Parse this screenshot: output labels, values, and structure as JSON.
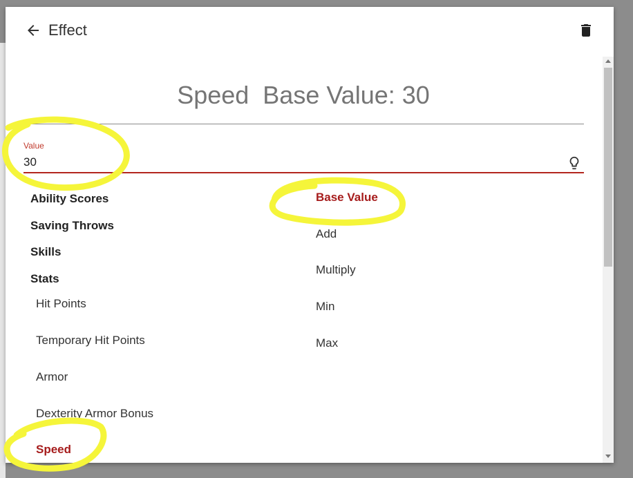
{
  "dialog": {
    "title": "Effect",
    "heading": "Speed  Base Value: 30"
  },
  "icons": {
    "back": "arrow-left-icon",
    "delete": "trash-icon",
    "hint": "lightbulb-icon"
  },
  "value_field": {
    "label": "Value",
    "value": "30"
  },
  "categories": [
    {
      "label": "Ability Scores"
    },
    {
      "label": "Saving Throws"
    },
    {
      "label": "Skills"
    },
    {
      "label": "Stats"
    }
  ],
  "stats_items": [
    {
      "label": "Hit Points",
      "selected": false
    },
    {
      "label": "Temporary Hit Points",
      "selected": false
    },
    {
      "label": "Armor",
      "selected": false
    },
    {
      "label": "Dexterity Armor Bonus",
      "selected": false
    },
    {
      "label": "Speed",
      "selected": true
    }
  ],
  "operations": [
    {
      "label": "Base Value",
      "selected": true
    },
    {
      "label": "Add",
      "selected": false
    },
    {
      "label": "Multiply",
      "selected": false
    },
    {
      "label": "Min",
      "selected": false
    },
    {
      "label": "Max",
      "selected": false
    }
  ],
  "colors": {
    "accent": "#a61c1c",
    "annotation": "#f5f53a"
  }
}
